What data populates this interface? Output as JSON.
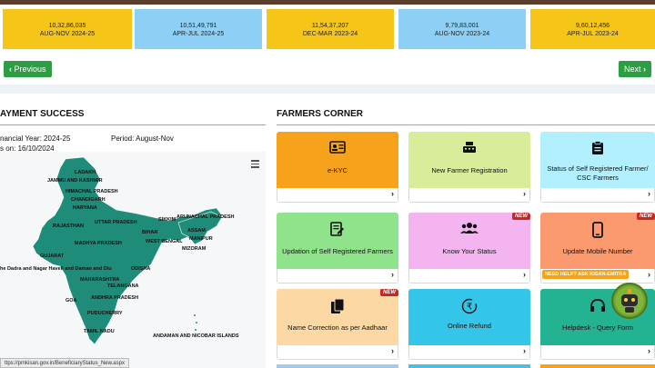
{
  "stats": [
    {
      "amount": "10,32,86,035",
      "period": "AUG-NOV 2024-25",
      "color": "#f5c518"
    },
    {
      "amount": "10,51,49,791",
      "period": "APR-JUL 2024-25",
      "color": "#8ecff5"
    },
    {
      "amount": "11,54,37,207",
      "period": "DEC-MAR 2023-24",
      "color": "#f5c518"
    },
    {
      "amount": "9,79,83,001",
      "period": "AUG-NOV 2023-24",
      "color": "#8ecff5"
    },
    {
      "amount": "9,60,12,456",
      "period": "APR-JUL 2023-24",
      "color": "#f5c518"
    }
  ],
  "nav": {
    "previous": "Previous",
    "next": "Next"
  },
  "payment": {
    "title": "AYMENT SUCCESS",
    "financial_year": "nancial Year: 2024-25",
    "period": "Period: August-Nov",
    "updated_on": "s on: 16/10/2024"
  },
  "map": {
    "labels": {
      "ladakh": "LADAKH",
      "jk": "JAMMU AND KASHMIR",
      "hp": "HIMACHAL PRADESH",
      "chandigarh": "CHANDIGARH",
      "haryana": "HARYANA",
      "up": "UTTAR PRADESH",
      "rajasthan": "RAJASTHAN",
      "bihar": "BIHAR",
      "mp": "MADHYA PRADESH",
      "wb": "WEST BENGAL",
      "sikkim": "SIKKIM",
      "arunachal": "ARUNACHAL PRADESH",
      "assam": "ASSAM",
      "manipur": "MANIPUR",
      "mizoram": "MIZORAM",
      "gujarat": "GUJARAT",
      "dnh": "he Dadra and Nagar Haveli and Daman and Diu",
      "odisha": "ODISHA",
      "maharashtra": "MAHARASHTRA",
      "telangana": "TELANGANA",
      "goa": "GOA",
      "ap": "ANDHRA PRADESH",
      "puducherry": "PUDUCHERRY",
      "tn": "TAMIL NADU",
      "andaman": "ANDAMAN AND NICOBAR ISLANDS"
    },
    "fill_color": "#1f8c7a"
  },
  "farmers_corner": {
    "title": "FARMERS CORNER",
    "cards": [
      {
        "label": "e-KYC",
        "icon": "id-card-icon",
        "color": "#f7a21b",
        "new": ""
      },
      {
        "label": "New Farmer Registration",
        "icon": "cash-register-icon",
        "color": "#d8ec9a",
        "new": ""
      },
      {
        "label": "Status of Self Registered Farmer/ CSC Farmers",
        "icon": "clipboard-icon",
        "color": "#b3f0ff",
        "new": ""
      },
      {
        "label": "Updation of Self Registered Farmers",
        "icon": "edit-document-icon",
        "color": "#8fe38a",
        "new": ""
      },
      {
        "label": "Know Your Status",
        "icon": "users-icon",
        "color": "#f3b4f0",
        "new": "NEW"
      },
      {
        "label": "Update Mobile Number",
        "icon": "mobile-icon",
        "color": "#fb9a6e",
        "new": "NEW"
      },
      {
        "label": "Name Correction as per Aadhaar",
        "icon": "copy-icon",
        "color": "#fcd9a4",
        "new": "NEW"
      },
      {
        "label": "Online Refund",
        "icon": "rupee-icon",
        "color": "#33c6e9",
        "new": ""
      },
      {
        "label": "Helpdesk - Query Form",
        "icon": "headset-icon",
        "color": "#23b392",
        "new": ""
      }
    ],
    "help_chip": "NEED HELP? ASK KISAN-EMITRA"
  },
  "status_bar": {
    "url": "ttps://pmkisan.gov.in/BeneficiaryStatus_New.aspx"
  }
}
